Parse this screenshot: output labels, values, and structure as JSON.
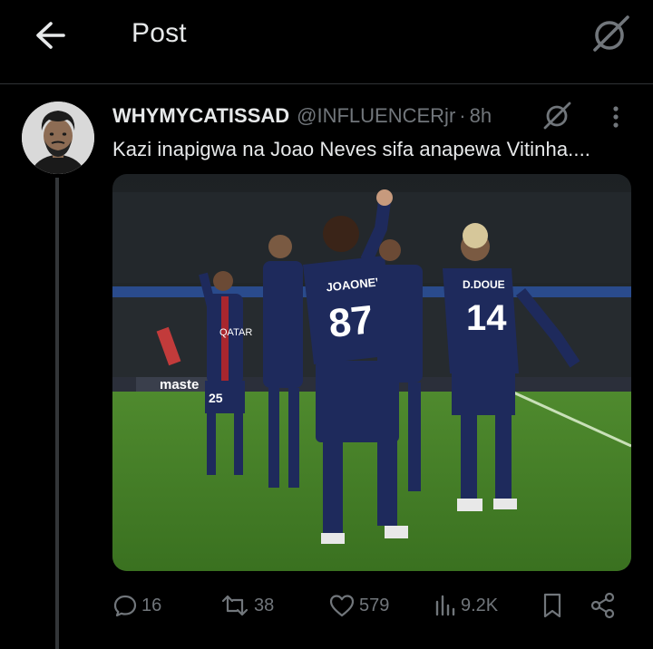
{
  "header": {
    "title": "Post",
    "back_icon": "arrow-left-icon",
    "grok_icon": "grok-slash-icon"
  },
  "tweet": {
    "display_name": "WHYMYCATISSAD",
    "handle": "@INFLUENCERjr",
    "separator": "·",
    "time": "8h",
    "text": "Kazi inapigwa na Joao Neves sifa anapewa Vitinha....",
    "media": {
      "board_text": "maste",
      "sponsor_text": "QATAR",
      "players": [
        {
          "name": "JOAONEVES",
          "number": "87"
        },
        {
          "name": "D.DOUE",
          "number": "14"
        },
        {
          "name": "",
          "number": "25"
        }
      ]
    }
  },
  "actions": {
    "replies": "16",
    "reposts": "38",
    "likes": "579",
    "views": "9.2K"
  },
  "colors": {
    "background": "#000000",
    "text": "#e7e9ea",
    "muted": "#71767b",
    "divider": "#2f3336"
  }
}
